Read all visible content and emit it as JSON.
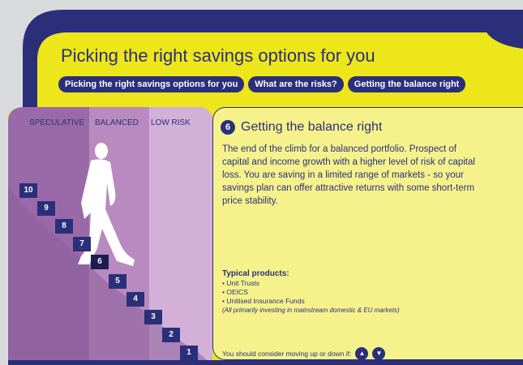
{
  "header": {
    "title": "Picking the right savings options for you"
  },
  "tabs": [
    {
      "label": "Picking the right savings options for you"
    },
    {
      "label": "What are the risks?"
    },
    {
      "label": "Getting the balance right"
    }
  ],
  "risk_columns": [
    {
      "label": "SPECULATIVE",
      "color": "#9a6aa8"
    },
    {
      "label": "BALANCED",
      "color": "#b88ac0"
    },
    {
      "label": "LOW RISK",
      "color": "#d2b0d8"
    }
  ],
  "steps": [
    "10",
    "9",
    "8",
    "7",
    "6",
    "5",
    "4",
    "3",
    "2",
    "1"
  ],
  "panel": {
    "number": "6",
    "title": "Getting the balance right",
    "body": "The end of the climb for a balanced portfolio. Prospect of capital and income growth with a higher level of risk of capital loss. You are saving in a limited range of markets - so your savings plan can offer attractive returns with some short-term price stability.",
    "products_heading": "Typical products:",
    "products": [
      "• Unit Trusts",
      "• OEICS",
      "• Unitised Insurance Funds"
    ],
    "products_note": "(All primarily investing in mainstream domestic & EU markets)",
    "consider_text": "You should consider moving up or down if:"
  },
  "icons": {
    "up": "up-arrow-icon",
    "down": "down-arrow-icon"
  },
  "colors": {
    "navy": "#2b2f7a",
    "yellow": "#ece61b",
    "panel": "#f5f28c"
  }
}
